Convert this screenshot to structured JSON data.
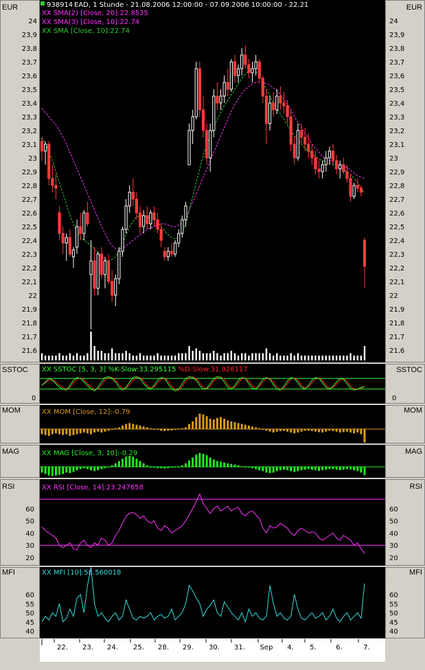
{
  "header": {
    "symbol_id": "938914",
    "description": "EAD, 1 Stunde - 21.08.2006 12:00:00 - 07.09.2006 10:00:00 - 22.21"
  },
  "colors": {
    "panel_bg": "#000000",
    "frame_bg": "#d4d0c8",
    "up_candle": "#ffffff",
    "down_candle": "#ff3b3b",
    "volume": "#ffffff",
    "sma20": "#ff33ff",
    "sma10": "#33cc33",
    "stoch_k": "#33ff33",
    "stoch_d": "#ff2222",
    "mom": "#d99b1c",
    "mag": "#22ee22",
    "rsi": "#ff33ff",
    "mfi": "#33dddd"
  },
  "panels": {
    "price": {
      "label": "EUR",
      "legend": [
        {
          "text": "XX SMA(2) [Close, 20]:22.8535",
          "color": "#ff33ff"
        },
        {
          "text": "XX SMA(3) [Close, 10]:22.74",
          "color": "#ff33ff"
        },
        {
          "text": "XX SMA [Close, 10]:22.74",
          "color": "#33cc33"
        }
      ],
      "ticks": [
        "24",
        "23,9",
        "23,8",
        "23,7",
        "23,6",
        "23,5",
        "23,4",
        "23,3",
        "23,2",
        "23,1",
        "23",
        "22,9",
        "22,8",
        "22,7",
        "22,6",
        "22,5",
        "22,4",
        "22,3",
        "22,2",
        "22,1",
        "22",
        "21,9",
        "21,8",
        "21,7",
        "21,6"
      ]
    },
    "sstoc": {
      "label": "SSTOC",
      "legend_parts": [
        {
          "text": "XX SSTOC [5, 3, 3] %K-Slow:33.295115 ",
          "color": "#33ff33"
        },
        {
          "text": "%D-Slow:31.926117",
          "color": "#ff2222"
        }
      ],
      "ticks": [
        "0"
      ]
    },
    "mom": {
      "label": "MOM",
      "legend": "XX MOM [Close, 12]:-0.79"
    },
    "mag": {
      "label": "MAG",
      "legend": "XX MAG [Close, 3, 10]:-0.29"
    },
    "rsi": {
      "label": "RSI",
      "legend": "XX RSI [Close, 14]:23.247658",
      "ticks": [
        "60",
        "50",
        "40",
        "30",
        "20"
      ]
    },
    "mfi": {
      "label": "MFI",
      "legend": "XX MFI [10]:58.560018",
      "ticks": [
        "60",
        "55",
        "50",
        "45",
        "40"
      ]
    }
  },
  "x_axis": {
    "labels": [
      "22.",
      "23.",
      "24.",
      "25.",
      "28.",
      "29.",
      "30.",
      "31.",
      "Sep",
      "4.",
      "5.",
      "6.",
      "7."
    ]
  },
  "chart_data": {
    "type": "candlestick",
    "title": "EAD, 1 Stunde - 21.08.2006 12:00:00 - 07.09.2006 10:00:00 - 22.21",
    "ylabel": "EUR",
    "ylim": [
      21.55,
      24.1
    ],
    "x_categories": [
      "22.",
      "23.",
      "24.",
      "25.",
      "28.",
      "29.",
      "30.",
      "31.",
      "Sep",
      "4.",
      "5.",
      "6.",
      "7."
    ],
    "candles": [
      [
        23.12,
        23.15,
        22.98,
        23.05
      ],
      [
        23.05,
        23.12,
        22.95,
        23.1
      ],
      [
        23.1,
        23.12,
        22.8,
        22.85
      ],
      [
        22.85,
        22.95,
        22.75,
        22.8
      ],
      [
        22.8,
        22.88,
        22.7,
        22.78
      ],
      [
        22.6,
        22.65,
        22.4,
        22.45
      ],
      [
        22.45,
        22.5,
        22.3,
        22.38
      ],
      [
        22.38,
        22.45,
        22.25,
        22.42
      ],
      [
        22.42,
        22.48,
        22.28,
        22.3
      ],
      [
        22.28,
        22.35,
        22.2,
        22.33
      ],
      [
        22.35,
        22.55,
        22.3,
        22.5
      ],
      [
        22.5,
        22.6,
        22.4,
        22.45
      ],
      [
        22.45,
        22.62,
        22.4,
        22.6
      ],
      [
        22.6,
        22.68,
        22.5,
        22.52
      ],
      [
        22.15,
        22.4,
        21.75,
        22.25
      ],
      [
        22.25,
        22.35,
        22.0,
        22.05
      ],
      [
        22.05,
        22.32,
        22.0,
        22.3
      ],
      [
        22.3,
        22.35,
        22.12,
        22.15
      ],
      [
        22.15,
        22.28,
        22.05,
        22.25
      ],
      [
        22.25,
        22.3,
        22.08,
        22.1
      ],
      [
        22.1,
        22.18,
        21.95,
        22.0
      ],
      [
        22.0,
        22.15,
        21.92,
        22.12
      ],
      [
        22.12,
        22.35,
        22.08,
        22.32
      ],
      [
        22.32,
        22.5,
        22.28,
        22.48
      ],
      [
        22.48,
        22.7,
        22.45,
        22.65
      ],
      [
        22.65,
        22.8,
        22.6,
        22.75
      ],
      [
        22.75,
        22.85,
        22.65,
        22.7
      ],
      [
        22.7,
        22.75,
        22.55,
        22.6
      ],
      [
        22.6,
        22.65,
        22.45,
        22.5
      ],
      [
        22.5,
        22.62,
        22.45,
        22.58
      ],
      [
        22.58,
        22.65,
        22.48,
        22.52
      ],
      [
        22.52,
        22.62,
        22.48,
        22.6
      ],
      [
        22.6,
        22.65,
        22.5,
        22.55
      ],
      [
        22.55,
        22.6,
        22.45,
        22.48
      ],
      [
        22.48,
        22.52,
        22.35,
        22.4
      ],
      [
        22.32,
        22.35,
        22.25,
        22.28
      ],
      [
        22.28,
        22.35,
        22.25,
        22.32
      ],
      [
        22.32,
        22.38,
        22.28,
        22.3
      ],
      [
        22.3,
        22.4,
        22.28,
        22.38
      ],
      [
        22.38,
        22.48,
        22.35,
        22.45
      ],
      [
        22.45,
        22.58,
        22.42,
        22.55
      ],
      [
        22.55,
        22.68,
        22.5,
        22.65
      ],
      [
        22.95,
        23.25,
        22.95,
        23.2
      ],
      [
        23.2,
        23.35,
        23.1,
        23.3
      ],
      [
        23.3,
        23.7,
        23.28,
        23.65
      ],
      [
        23.65,
        23.7,
        23.3,
        23.35
      ],
      [
        23.35,
        23.45,
        23.15,
        23.2
      ],
      [
        23.2,
        23.25,
        22.95,
        23.0
      ],
      [
        23.0,
        23.25,
        22.9,
        23.2
      ],
      [
        23.2,
        23.5,
        23.15,
        23.45
      ],
      [
        23.45,
        23.55,
        23.35,
        23.4
      ],
      [
        23.4,
        23.5,
        23.35,
        23.45
      ],
      [
        23.45,
        23.6,
        23.4,
        23.55
      ],
      [
        23.55,
        23.65,
        23.45,
        23.5
      ],
      [
        23.5,
        23.72,
        23.48,
        23.7
      ],
      [
        23.7,
        23.75,
        23.55,
        23.6
      ],
      [
        23.6,
        23.68,
        23.55,
        23.65
      ],
      [
        23.65,
        23.8,
        23.6,
        23.75
      ],
      [
        23.75,
        23.82,
        23.65,
        23.68
      ],
      [
        23.68,
        23.72,
        23.58,
        23.62
      ],
      [
        23.62,
        23.7,
        23.55,
        23.65
      ],
      [
        23.65,
        23.75,
        23.6,
        23.7
      ],
      [
        23.7,
        23.72,
        23.55,
        23.58
      ],
      [
        23.58,
        23.6,
        23.4,
        23.45
      ],
      [
        23.45,
        23.5,
        23.1,
        23.25
      ],
      [
        23.25,
        23.45,
        23.2,
        23.4
      ],
      [
        23.4,
        23.48,
        23.3,
        23.35
      ],
      [
        23.35,
        23.5,
        23.32,
        23.45
      ],
      [
        23.45,
        23.52,
        23.35,
        23.4
      ],
      [
        23.4,
        23.48,
        23.32,
        23.38
      ],
      [
        23.38,
        23.42,
        23.25,
        23.3
      ],
      [
        23.3,
        23.35,
        23.05,
        23.1
      ],
      [
        23.1,
        23.15,
        22.95,
        23.0
      ],
      [
        23.0,
        23.25,
        22.98,
        23.2
      ],
      [
        23.2,
        23.25,
        23.1,
        23.15
      ],
      [
        23.15,
        23.22,
        23.05,
        23.1
      ],
      [
        23.1,
        23.18,
        23.0,
        23.05
      ],
      [
        23.05,
        23.1,
        22.95,
        23.0
      ],
      [
        23.0,
        23.05,
        22.88,
        22.92
      ],
      [
        22.92,
        22.98,
        22.85,
        22.9
      ],
      [
        22.9,
        22.98,
        22.85,
        22.95
      ],
      [
        22.95,
        23.05,
        22.9,
        23.0
      ],
      [
        23.0,
        23.08,
        22.95,
        23.05
      ],
      [
        23.05,
        23.1,
        22.95,
        22.98
      ],
      [
        22.98,
        23.02,
        22.88,
        22.92
      ],
      [
        22.92,
        22.98,
        22.85,
        22.95
      ],
      [
        22.95,
        23.0,
        22.88,
        22.9
      ],
      [
        22.9,
        22.95,
        22.82,
        22.85
      ],
      [
        22.85,
        22.88,
        22.68,
        22.72
      ],
      [
        22.72,
        22.82,
        22.7,
        22.8
      ],
      [
        22.8,
        22.85,
        22.75,
        22.78
      ],
      [
        22.78,
        22.8,
        22.72,
        22.75
      ],
      [
        22.4,
        22.42,
        22.05,
        22.21
      ]
    ],
    "sma20": [
      23.36,
      23.33,
      23.3,
      23.27,
      23.24,
      23.2,
      23.15,
      23.1,
      23.04,
      22.98,
      22.92,
      22.86,
      22.8,
      22.74,
      22.68,
      22.62,
      22.56,
      22.5,
      22.45,
      22.4,
      22.36,
      22.34,
      22.33,
      22.34,
      22.36,
      22.38,
      22.4,
      22.42,
      22.44,
      22.46,
      22.48,
      22.49,
      22.5,
      22.51,
      22.52,
      22.52,
      22.51,
      22.5,
      22.5,
      22.51,
      22.53,
      22.56,
      22.62,
      22.68,
      22.74,
      22.8,
      22.86,
      22.92,
      22.98,
      23.04,
      23.1,
      23.16,
      23.22,
      23.28,
      23.34,
      23.39,
      23.43,
      23.47,
      23.5,
      23.52,
      23.54,
      23.55,
      23.55,
      23.55,
      23.54,
      23.53,
      23.51,
      23.49,
      23.46,
      23.43,
      23.39,
      23.35,
      23.3,
      23.26,
      23.22,
      23.18,
      23.14,
      23.1,
      23.07,
      23.04,
      23.01,
      22.99,
      22.98,
      22.97,
      22.96,
      22.95,
      22.94,
      22.93,
      22.91,
      22.89,
      22.87,
      22.86,
      22.85
    ],
    "sma10": [
      23.15,
      23.1,
      23.05,
      22.98,
      22.9,
      22.82,
      22.74,
      22.66,
      22.58,
      22.52,
      22.46,
      22.42,
      22.4,
      22.38,
      22.36,
      22.34,
      22.3,
      22.28,
      22.26,
      22.25,
      22.26,
      22.28,
      22.32,
      22.38,
      22.44,
      22.5,
      22.54,
      22.57,
      22.58,
      22.58,
      22.57,
      22.56,
      22.55,
      22.53,
      22.5,
      22.47,
      22.44,
      22.42,
      22.41,
      22.42,
      22.46,
      22.52,
      22.62,
      22.72,
      22.82,
      22.92,
      23.02,
      23.1,
      23.16,
      23.22,
      23.28,
      23.33,
      23.38,
      23.42,
      23.46,
      23.5,
      23.54,
      23.58,
      23.61,
      23.63,
      23.64,
      23.63,
      23.6,
      23.55,
      23.5,
      23.45,
      23.4,
      23.36,
      23.32,
      23.28,
      23.24,
      23.2,
      23.16,
      23.13,
      23.1,
      23.07,
      23.05,
      23.03,
      23.01,
      22.99,
      22.98,
      22.97,
      22.96,
      22.95,
      22.94,
      22.93,
      22.92,
      22.9,
      22.88,
      22.85,
      22.82,
      22.78,
      22.74
    ],
    "volume": [
      3,
      2,
      2,
      2,
      2,
      3,
      2,
      2,
      3,
      2,
      3,
      2,
      2,
      3,
      12,
      6,
      4,
      4,
      3,
      3,
      5,
      3,
      3,
      3,
      4,
      3,
      2,
      2,
      3,
      2,
      2,
      2,
      2,
      3,
      2,
      2,
      2,
      2,
      2,
      3,
      3,
      3,
      6,
      4,
      5,
      4,
      3,
      3,
      3,
      4,
      3,
      2,
      3,
      3,
      4,
      3,
      2,
      3,
      3,
      2,
      3,
      3,
      3,
      3,
      5,
      3,
      2,
      3,
      2,
      2,
      2,
      3,
      2,
      3,
      2,
      2,
      2,
      2,
      2,
      2,
      2,
      2,
      2,
      2,
      2,
      2,
      2,
      2,
      3,
      2,
      2,
      2,
      6
    ],
    "sstoc_k": [
      40,
      60,
      80,
      70,
      50,
      30,
      20,
      15,
      40,
      70,
      85,
      80,
      60,
      40,
      20,
      10,
      30,
      60,
      85,
      90,
      80,
      60,
      30,
      15,
      30,
      60,
      85,
      90,
      80,
      50,
      30,
      20,
      40,
      70,
      85,
      80,
      50,
      20,
      10,
      20,
      50,
      80,
      90,
      85,
      70,
      40,
      20,
      25,
      50,
      80,
      90,
      85,
      60,
      30,
      20,
      40,
      70,
      85,
      80,
      50,
      25,
      20,
      45,
      75,
      85,
      75,
      45,
      20,
      15,
      35,
      65,
      85,
      80,
      55,
      30,
      20,
      40,
      70,
      85,
      80,
      55,
      30,
      20,
      35,
      60,
      80,
      75,
      50,
      25,
      15,
      20,
      30,
      33
    ],
    "sstoc_d": [
      45,
      55,
      70,
      72,
      60,
      42,
      28,
      20,
      30,
      55,
      75,
      82,
      72,
      52,
      32,
      18,
      22,
      45,
      70,
      85,
      85,
      70,
      45,
      22,
      25,
      45,
      70,
      85,
      85,
      65,
      40,
      25,
      32,
      55,
      75,
      82,
      65,
      35,
      18,
      15,
      35,
      65,
      85,
      88,
      78,
      55,
      30,
      22,
      38,
      65,
      85,
      88,
      75,
      45,
      25,
      30,
      55,
      78,
      82,
      65,
      40,
      22,
      35,
      60,
      80,
      80,
      60,
      32,
      18,
      25,
      50,
      75,
      82,
      68,
      42,
      25,
      32,
      55,
      75,
      82,
      68,
      42,
      25,
      28,
      48,
      70,
      78,
      62,
      38,
      20,
      18,
      25,
      32
    ],
    "mom": [
      -0.3,
      -0.35,
      -0.4,
      -0.3,
      -0.25,
      -0.3,
      -0.35,
      -0.3,
      -0.4,
      -0.35,
      -0.3,
      -0.25,
      -0.2,
      -0.25,
      -0.3,
      -0.2,
      -0.15,
      -0.2,
      -0.15,
      -0.1,
      -0.05,
      0.05,
      0.1,
      0.2,
      0.3,
      0.35,
      0.3,
      0.25,
      0.2,
      0.15,
      0.1,
      0.05,
      0.0,
      -0.05,
      -0.1,
      -0.12,
      -0.1,
      -0.08,
      -0.05,
      0.0,
      0.05,
      0.1,
      0.3,
      0.45,
      0.7,
      0.9,
      0.85,
      0.75,
      0.6,
      0.55,
      0.65,
      0.7,
      0.6,
      0.5,
      0.45,
      0.4,
      0.35,
      0.3,
      0.25,
      0.2,
      0.15,
      0.1,
      0.05,
      -0.05,
      -0.1,
      -0.15,
      -0.2,
      -0.15,
      -0.12,
      -0.1,
      -0.15,
      -0.2,
      -0.25,
      -0.2,
      -0.15,
      -0.1,
      -0.1,
      -0.12,
      -0.15,
      -0.18,
      -0.2,
      -0.15,
      -0.1,
      -0.12,
      -0.15,
      -0.2,
      -0.18,
      -0.15,
      -0.2,
      -0.25,
      -0.2,
      -0.3,
      -0.79
    ],
    "mag": [
      -0.2,
      -0.25,
      -0.3,
      -0.32,
      -0.3,
      -0.28,
      -0.25,
      -0.2,
      -0.22,
      -0.18,
      -0.12,
      -0.08,
      -0.05,
      -0.08,
      -0.12,
      -0.15,
      -0.12,
      -0.08,
      -0.05,
      0.0,
      0.05,
      0.12,
      0.2,
      0.28,
      0.35,
      0.38,
      0.35,
      0.28,
      0.2,
      0.12,
      0.05,
      0.0,
      -0.03,
      -0.05,
      -0.05,
      -0.06,
      -0.05,
      -0.03,
      -0.02,
      0.0,
      0.05,
      0.12,
      0.22,
      0.32,
      0.42,
      0.48,
      0.45,
      0.4,
      0.32,
      0.25,
      0.2,
      0.18,
      0.15,
      0.12,
      0.1,
      0.08,
      0.05,
      0.02,
      0.0,
      -0.02,
      -0.05,
      -0.08,
      -0.12,
      -0.15,
      -0.2,
      -0.22,
      -0.2,
      -0.15,
      -0.12,
      -0.1,
      -0.12,
      -0.15,
      -0.18,
      -0.15,
      -0.12,
      -0.1,
      -0.08,
      -0.1,
      -0.12,
      -0.14,
      -0.12,
      -0.1,
      -0.08,
      -0.08,
      -0.1,
      -0.12,
      -0.1,
      -0.08,
      -0.1,
      -0.12,
      -0.15,
      -0.2,
      -0.29
    ],
    "rsi": [
      45,
      42,
      40,
      38,
      36,
      30,
      28,
      30,
      32,
      27,
      26,
      32,
      34,
      30,
      28,
      32,
      30,
      36,
      34,
      30,
      32,
      38,
      42,
      48,
      54,
      56,
      57,
      55,
      52,
      54,
      50,
      48,
      50,
      44,
      42,
      46,
      44,
      40,
      42,
      44,
      46,
      50,
      55,
      60,
      66,
      72,
      64,
      60,
      56,
      60,
      62,
      58,
      60,
      62,
      58,
      60,
      61,
      56,
      54,
      57,
      58,
      55,
      52,
      44,
      40,
      46,
      44,
      45,
      48,
      46,
      44,
      40,
      38,
      42,
      44,
      42,
      40,
      41,
      40,
      36,
      34,
      36,
      38,
      40,
      36,
      34,
      38,
      36,
      34,
      30,
      32,
      27,
      23.2
    ],
    "mfi": [
      45,
      48,
      46,
      50,
      48,
      55,
      45,
      47,
      52,
      48,
      58,
      60,
      50,
      65,
      75,
      55,
      48,
      50,
      47,
      45,
      48,
      50,
      46,
      48,
      57,
      52,
      47,
      46,
      48,
      47,
      48,
      50,
      46,
      48,
      49,
      47,
      48,
      52,
      46,
      48,
      50,
      55,
      65,
      62,
      58,
      55,
      48,
      52,
      54,
      57,
      50,
      48,
      56,
      53,
      50,
      48,
      46,
      50,
      45,
      52,
      48,
      50,
      47,
      46,
      48,
      65,
      55,
      48,
      50,
      47,
      46,
      48,
      60,
      52,
      47,
      46,
      48,
      50,
      47,
      48,
      50,
      46,
      48,
      52,
      47,
      45,
      48,
      50,
      46,
      48,
      50,
      47,
      66
    ]
  }
}
